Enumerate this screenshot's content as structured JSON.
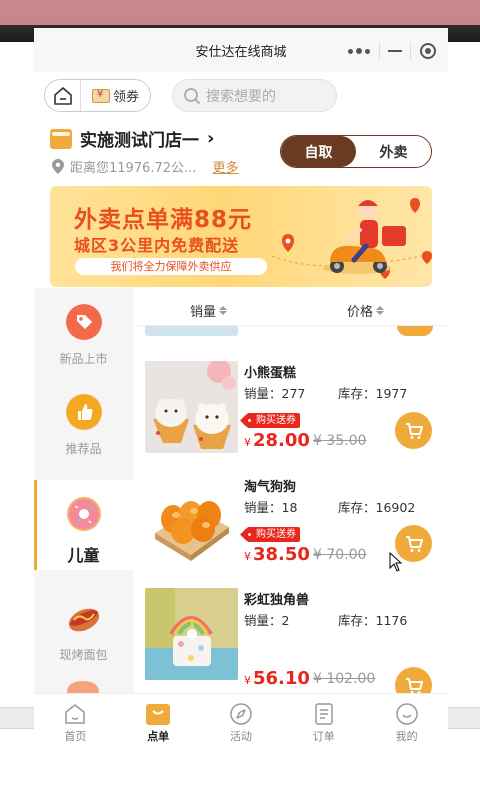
{
  "window": {
    "title": "安仕达在线商城"
  },
  "topbar": {
    "coupon_label": "领券",
    "search_placeholder": "搜索想要的"
  },
  "store": {
    "name": "实施测试门店一",
    "distance": "距离您11976.72公...",
    "more_label": "更多",
    "mode_selected": "自取",
    "mode_other": "外卖"
  },
  "banner": {
    "headline": "外卖点单满88元",
    "subline": "城区3公里内免费配送",
    "note": "我们将全力保障外卖供应"
  },
  "sort": {
    "sales_label": "销量",
    "price_label": "价格"
  },
  "categories": [
    {
      "label": "新品上市",
      "icon": "tag-icon",
      "color": "#f26a4a"
    },
    {
      "label": "推荐品",
      "icon": "thumbs-up-icon",
      "color": "#f5a623"
    },
    {
      "label": "儿童",
      "icon": "donut-icon",
      "color": "#f48a9b",
      "active": true
    },
    {
      "label": "现烤面包",
      "icon": "hotdog-icon",
      "color": "#d9713a"
    }
  ],
  "products": [
    {
      "name": "小熊蛋糕",
      "sales_label": "销量：",
      "sales": "277",
      "stock_label": "库存：",
      "stock": "1977",
      "tag": "购买送券",
      "currency": "¥",
      "price": "28.00",
      "old_price": "¥ 35.00"
    },
    {
      "name": "淘气狗狗",
      "sales_label": "销量：",
      "sales": "18",
      "stock_label": "库存：",
      "stock": "16902",
      "tag": "购买送券",
      "currency": "¥",
      "price": "38.50",
      "old_price": "¥ 70.00"
    },
    {
      "name": "彩虹独角兽",
      "sales_label": "销量：",
      "sales": "2",
      "stock_label": "库存：",
      "stock": "1176",
      "currency": "¥",
      "price": "56.10",
      "old_price": "¥ 102.00"
    }
  ],
  "tabbar": [
    {
      "label": "首页",
      "icon": "home-icon"
    },
    {
      "label": "点单",
      "icon": "bag-icon",
      "active": true
    },
    {
      "label": "活动",
      "icon": "compass-icon"
    },
    {
      "label": "订单",
      "icon": "receipt-icon"
    },
    {
      "label": "我的",
      "icon": "smile-icon"
    }
  ],
  "colors": {
    "accent": "#f0a93b",
    "brand_brown": "#6b3a22",
    "price_red": "#e8261b"
  }
}
